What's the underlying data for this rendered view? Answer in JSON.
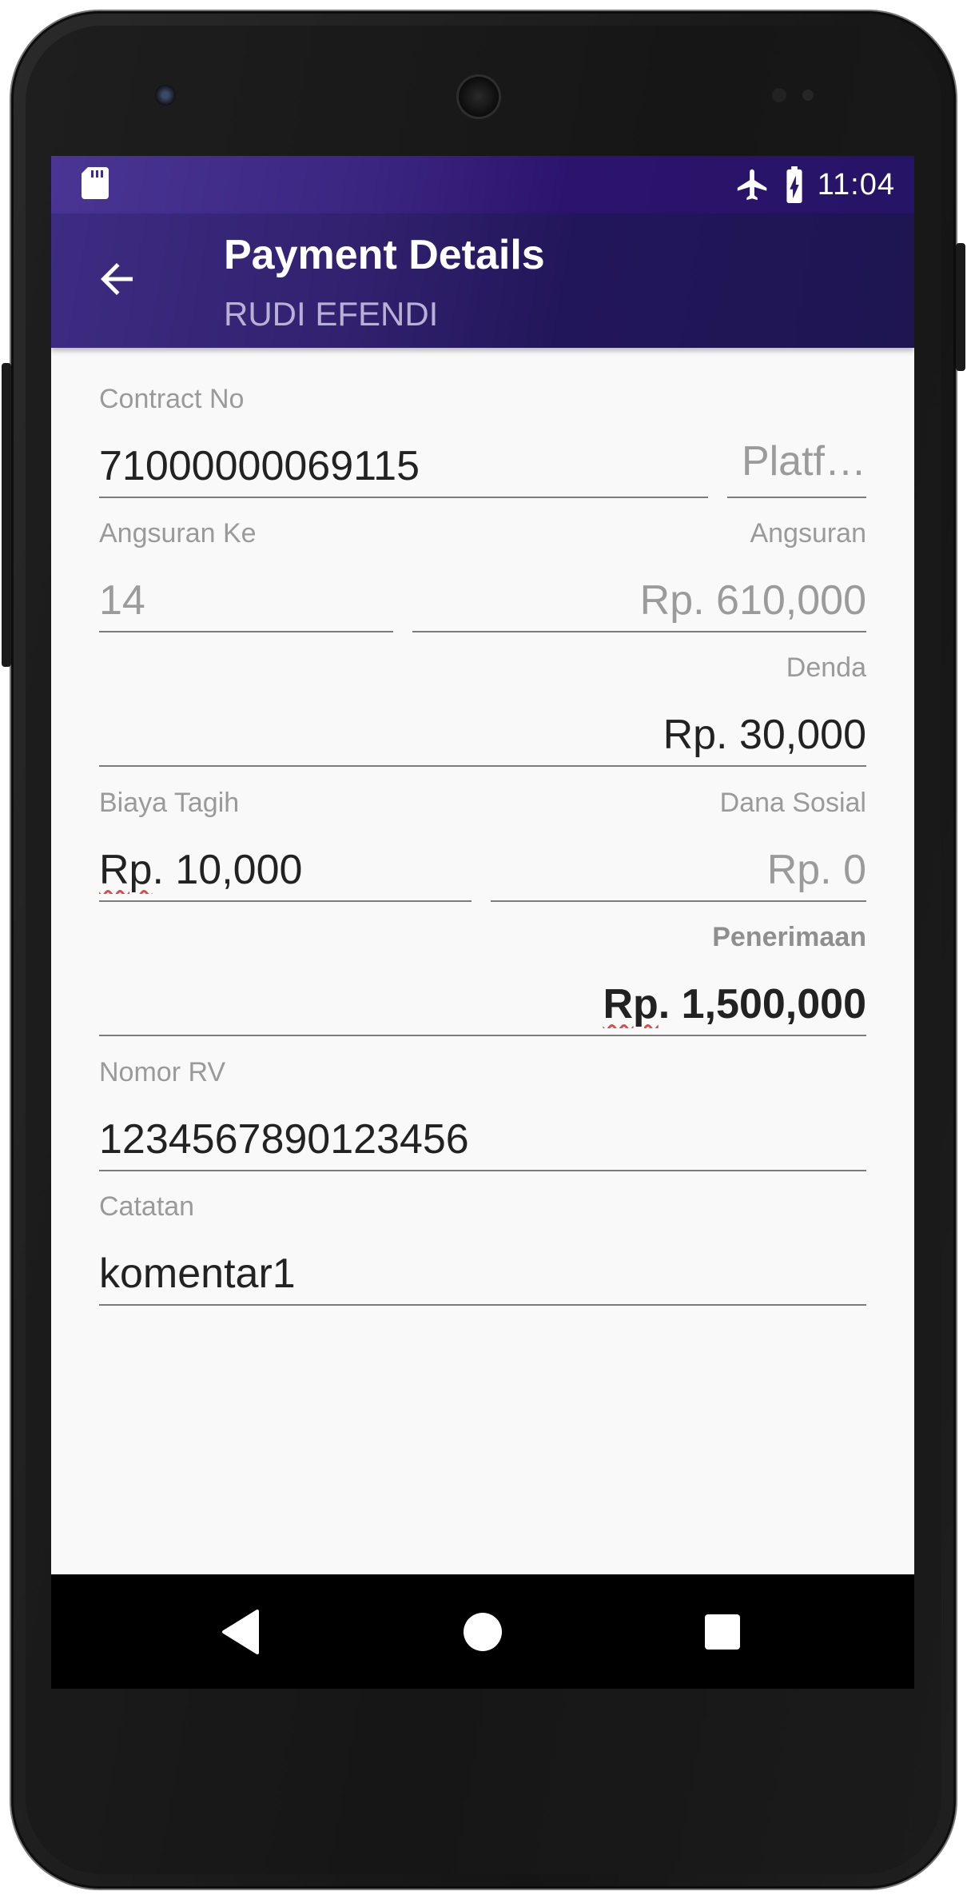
{
  "status_bar": {
    "time": "11:04",
    "icons": [
      "sd-card-icon",
      "airplane-mode-icon",
      "battery-charging-icon"
    ]
  },
  "app_bar": {
    "title": "Payment Details",
    "subtitle": "RUDI EFENDI"
  },
  "form": {
    "contract_no": {
      "label": "Contract No",
      "value": "71000000069115"
    },
    "platform": {
      "placeholder": "Platf…"
    },
    "angsuran_ke": {
      "label": "Angsuran Ke",
      "value": "14"
    },
    "angsuran": {
      "label": "Angsuran",
      "value": "Rp. 610,000"
    },
    "denda": {
      "label": "Denda",
      "value": "Rp. 30,000"
    },
    "biaya_tagih": {
      "label": "Biaya Tagih",
      "value_prefix": "Rp",
      "value_rest": ". 10,000"
    },
    "dana_sosial": {
      "label": "Dana Sosial",
      "value": "Rp. 0"
    },
    "penerimaan": {
      "label": "Penerimaan",
      "value_prefix": "Rp",
      "value_rest": ". 1,500,000"
    },
    "nomor_rv": {
      "label": "Nomor RV",
      "value": "1234567890123456"
    },
    "catatan": {
      "label": "Catatan",
      "value": "komentar1"
    }
  },
  "nav": {
    "buttons": [
      "back-triangle-icon",
      "home-circle-icon",
      "recents-square-icon"
    ]
  },
  "colors": {
    "status_bar": "#3b2782",
    "app_bar": "#2c1d6b",
    "screen_bg": "#f9f9f9",
    "underline": "#7c7c7c"
  }
}
